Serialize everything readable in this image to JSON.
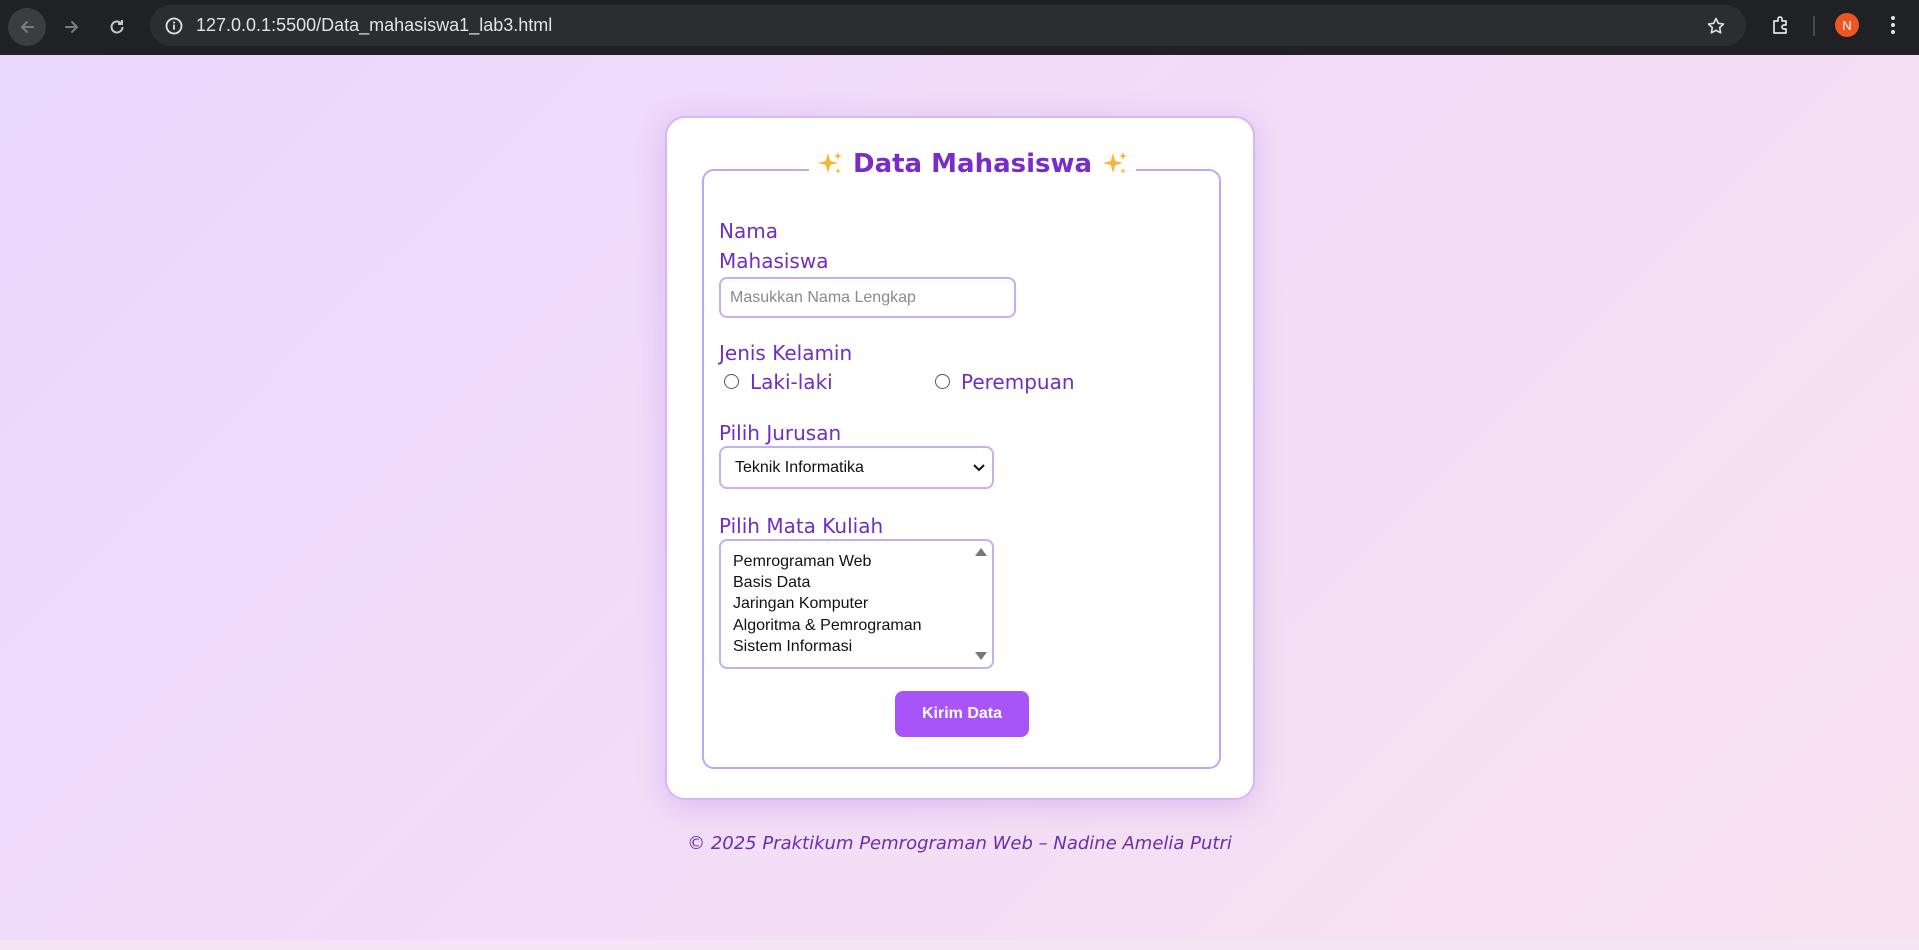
{
  "browser": {
    "url": "127.0.0.1:5500/Data_mahasiswa1_lab3.html",
    "profile_initial": "N",
    "profile_color": "#ee5522"
  },
  "form": {
    "title": "Data Mahasiswa",
    "title_icon": "sparkles-icon",
    "name_label_line1": "Nama",
    "name_label_line2": "Mahasiswa",
    "name_placeholder": "Masukkan Nama Lengkap",
    "name_value": "",
    "gender_label": "Jenis Kelamin",
    "gender_options": [
      "Laki-laki",
      "Perempuan"
    ],
    "major_label": "Pilih Jurusan",
    "major_selected": "Teknik Informatika",
    "courses_label": "Pilih Mata Kuliah",
    "courses": [
      "Pemrograman Web",
      "Basis Data",
      "Jaringan Komputer",
      "Algoritma & Pemrograman",
      "Sistem Informasi"
    ],
    "submit_label": "Kirim Data"
  },
  "footer": {
    "text": "© 2025 Praktikum Pemrograman Web – Nadine Amelia Putri"
  },
  "colors": {
    "accent": "#a855f7",
    "title": "#7a2cc8",
    "label": "#6f2fc0",
    "border": "#c7aef2"
  }
}
